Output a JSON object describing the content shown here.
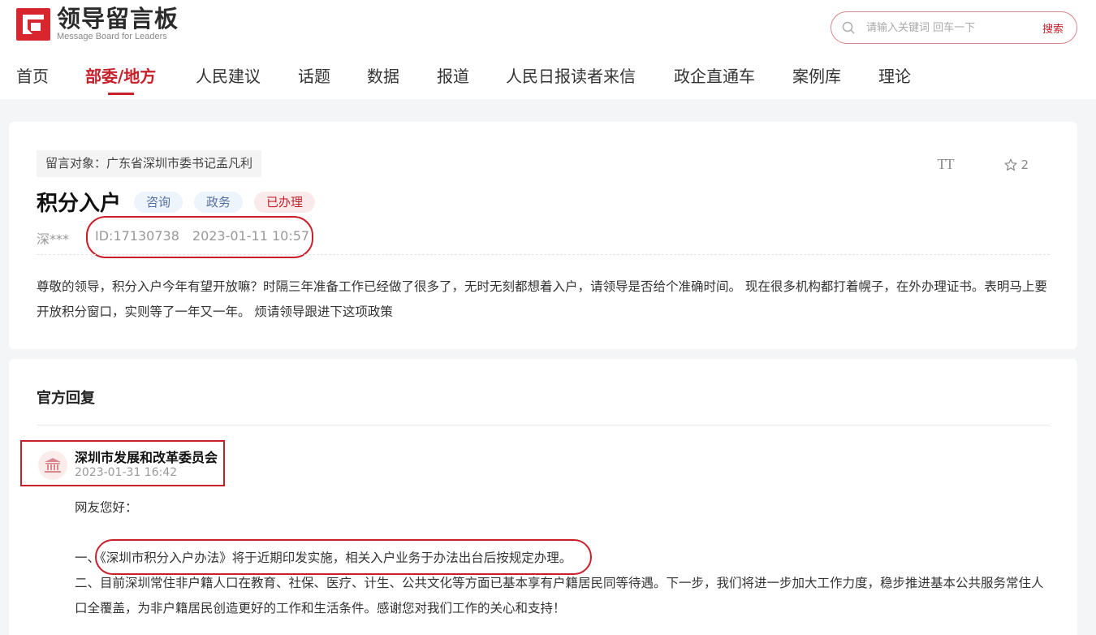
{
  "header": {
    "logo_title": "领导留言板",
    "logo_subtitle": "Message Board for Leaders",
    "search_placeholder": "请输入关键词 回车一下",
    "search_button": "搜索"
  },
  "nav": {
    "items": [
      "首页",
      "部委/地方",
      "人民建议",
      "话题",
      "数据",
      "报道",
      "人民日报读者来信",
      "政企直通车",
      "案例库",
      "理论"
    ],
    "active_index": 1
  },
  "message": {
    "target": "留言对象：广东省深圳市委书记孟凡利",
    "title": "积分入户",
    "tags": [
      "咨询",
      "政务",
      "已办理"
    ],
    "author": "深***",
    "id": "ID:17130738",
    "time": "2023-01-11 10:57",
    "favorite_count": "2",
    "font_tool": "TT",
    "content": "尊敬的领导，积分入户今年有望开放嘛？时隔三年准备工作已经做了很多了，无时无刻都想着入户，请领导是否给个准确时间。 现在很多机构都打着幌子，在外办理证书。表明马上要开放积分窗口，实则等了一年又一年。 烦请领导跟进下这项政策"
  },
  "reply": {
    "section_title": "官方回复",
    "department": "深圳市发展和改革委员会",
    "time": "2023-01-31 16:42",
    "paragraphs": [
      "网友您好：",
      "",
      "一、《深圳市积分入户办法》将于近期印发实施，相关入户业务于办法出台后按规定办理。",
      "二、目前深圳常住非户籍人口在教育、社保、医疗、计生、公共文化等方面已基本享有户籍居民同等待遇。下一步，我们将进一步加大工作力度，稳步推进基本公共服务常住人口全覆盖，为非户籍居民创造更好的工作和生活条件。感谢您对我们工作的关心和支持！"
    ]
  },
  "colors": {
    "brand_red": "#c8202b",
    "tag_blue_bg": "#eef4fb",
    "tag_red_bg": "#fbeaea"
  }
}
